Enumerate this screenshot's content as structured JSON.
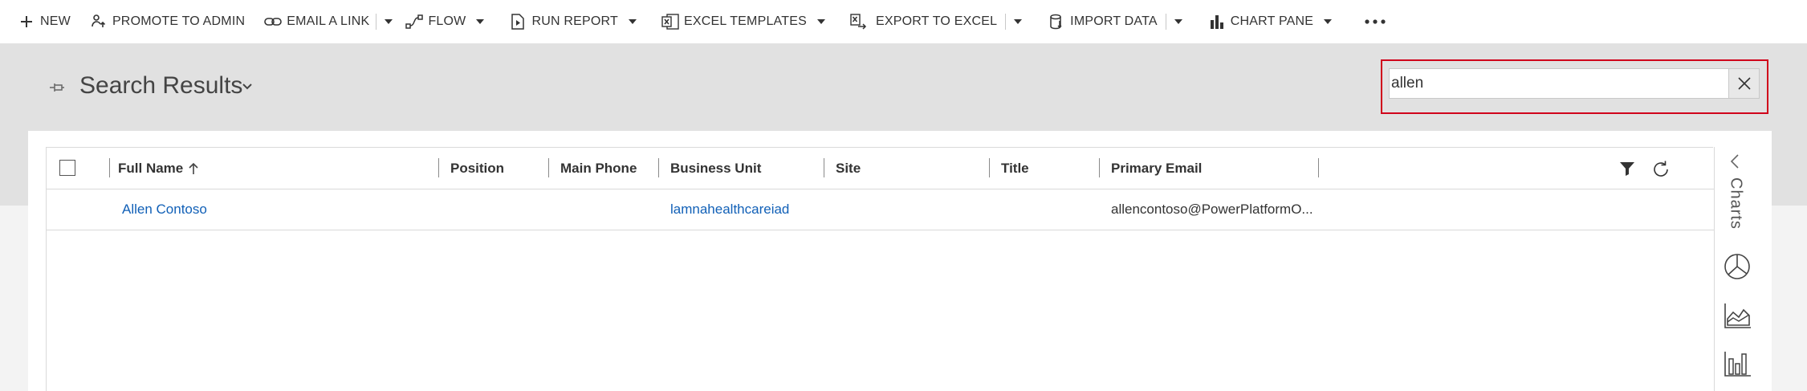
{
  "command_bar": {
    "new": "NEW",
    "promote_to_admin": "PROMOTE TO ADMIN",
    "email_a_link": "EMAIL A LINK",
    "flow": "FLOW",
    "run_report": "RUN REPORT",
    "excel_templates": "EXCEL TEMPLATES",
    "export_to_excel": "EXPORT TO EXCEL",
    "import_data": "IMPORT DATA",
    "chart_pane": "CHART PANE"
  },
  "header": {
    "title": "Search Results"
  },
  "search": {
    "value": "allen",
    "highlight_color": "#d0021b"
  },
  "grid": {
    "columns": [
      "Full Name",
      "Position",
      "Main Phone",
      "Business Unit",
      "Site",
      "Title",
      "Primary Email"
    ],
    "sort_column": "Full Name",
    "sort_direction": "ascending",
    "rows": [
      {
        "full_name": "Allen Contoso",
        "position": "",
        "main_phone": "",
        "business_unit": "lamnahealthcareiad",
        "site": "",
        "title": "",
        "primary_email": "allencontoso@PowerPlatformO..."
      }
    ]
  },
  "charts_pane": {
    "label": "Charts"
  },
  "colors": {
    "link": "#1160b7",
    "header_band": "#e1e1e1"
  }
}
